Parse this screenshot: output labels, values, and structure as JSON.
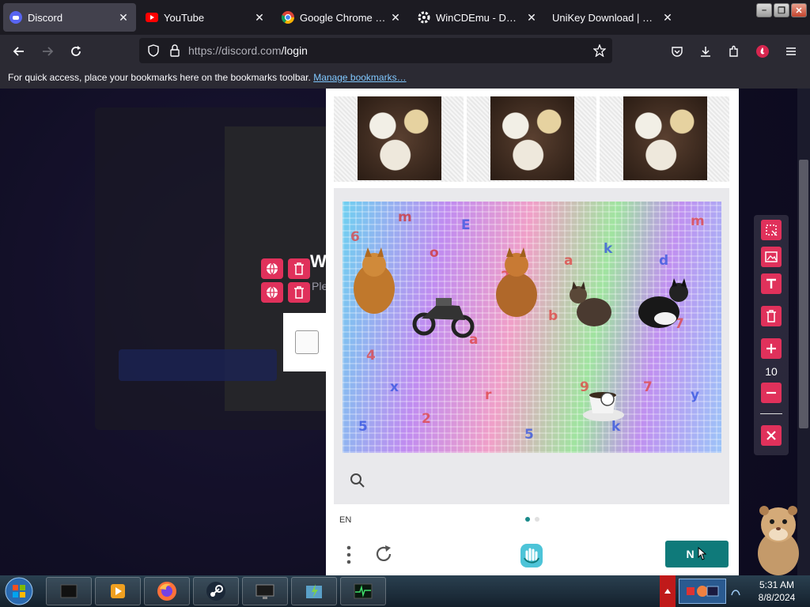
{
  "browser": {
    "tabs": [
      {
        "title": "Discord",
        "icon": "discord-icon",
        "active": true
      },
      {
        "title": "YouTube",
        "icon": "youtube-icon",
        "active": false
      },
      {
        "title": "Google Chrome - Th",
        "icon": "chrome-icon",
        "active": false
      },
      {
        "title": "WinCDEmu - Downl",
        "icon": "gear-icon",
        "active": false
      },
      {
        "title": "UniKey Download | UniK",
        "icon": "",
        "active": false
      }
    ],
    "tab_close": "✕",
    "url_host": "https://discord.com",
    "url_path": "/login",
    "bookmarks_text": "For quick access, place your bookmarks here on the bookmarks toolbar.",
    "bookmarks_link": "Manage bookmarks…"
  },
  "login": {
    "title_partial": "W",
    "subtitle_partial": "Ple"
  },
  "captcha": {
    "language": "EN",
    "next_label": "N",
    "page_count": 2,
    "active_page": 1
  },
  "side_panel": {
    "size_value": "10"
  },
  "taskbar": {
    "time": "5:31 AM",
    "date": "8/8/2024"
  },
  "colors": {
    "accent_pink": "#e0315b",
    "teal": "#0f7a7a"
  }
}
